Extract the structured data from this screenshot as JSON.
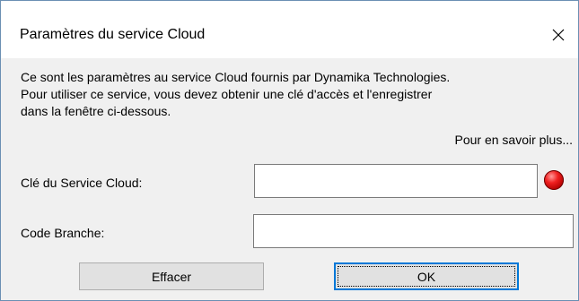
{
  "window": {
    "title": "Paramètres du service Cloud",
    "close_glyph": "×"
  },
  "description": "Ce sont les paramètres au service Cloud fournis par Dynamika Technologies.\nPour utiliser ce service, vous devez obtenir une clé d'accès et l'enregistrer\ndans la fenêtre ci-dessous.",
  "learn_more_link": "Pour en savoir plus...",
  "fields": {
    "cloud_key": {
      "label": "Clé du Service Cloud:",
      "value": "",
      "placeholder": "",
      "status": "not-connected",
      "status_color": "#e00000"
    },
    "branch_code": {
      "label": "Code Branche:",
      "value": "",
      "placeholder": ""
    }
  },
  "buttons": {
    "clear_label": "Effacer",
    "ok_label": "OK"
  },
  "colors": {
    "accent": "#0078d7",
    "dialog_bg": "#f0f0f0",
    "titlebar_bg": "#ffffff",
    "button_bg": "#e1e1e1"
  }
}
